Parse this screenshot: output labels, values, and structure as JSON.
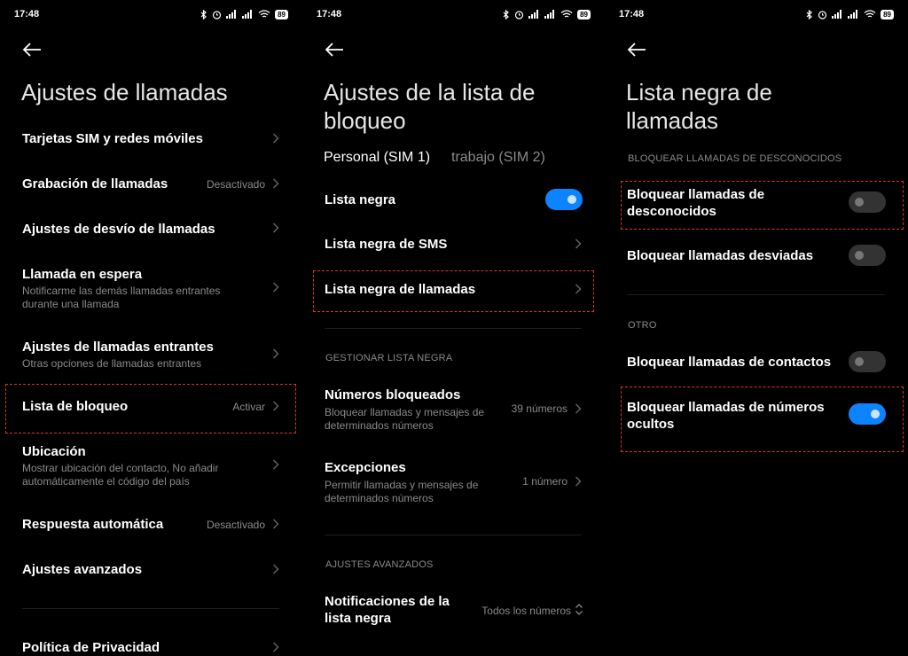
{
  "status": {
    "time": "17:48",
    "battery": "89"
  },
  "screen1": {
    "title": "Ajustes de llamadas",
    "items": [
      {
        "label": "Tarjetas SIM y redes móviles"
      },
      {
        "label": "Grabación de llamadas",
        "value": "Desactivado"
      },
      {
        "label": "Ajustes de desvío de llamadas"
      },
      {
        "label": "Llamada en espera",
        "sub1": "Notificarme las demás llamadas entrantes",
        "sub2": "durante una llamada"
      },
      {
        "label": "Ajustes de llamadas entrantes",
        "sub1": "Otras opciones de llamadas entrantes"
      },
      {
        "label": "Lista de bloqueo",
        "value": "Activar"
      },
      {
        "label": "Ubicación",
        "sub1": "Mostrar ubicación del contacto, No añadir",
        "sub2": "automáticamente el código del país"
      },
      {
        "label": "Respuesta automática",
        "value": "Desactivado"
      },
      {
        "label": "Ajustes avanzados"
      },
      {
        "label": "Política de Privacidad"
      }
    ]
  },
  "screen2": {
    "title1": "Ajustes de la lista de",
    "title2": "bloqueo",
    "tabs": [
      {
        "label": "Personal (SIM 1)"
      },
      {
        "label": "trabajo (SIM 2)"
      }
    ],
    "items": [
      {
        "label": "Lista negra",
        "toggle": true
      },
      {
        "label": "Lista negra de SMS"
      },
      {
        "label": "Lista negra de llamadas"
      }
    ],
    "section_manage": "GESTIONAR LISTA NEGRA",
    "manage_items": [
      {
        "label": "Números bloqueados",
        "sub1": "Bloquear llamadas y mensajes de",
        "sub2": "determinados números",
        "value": "39 números"
      },
      {
        "label": "Excepciones",
        "sub1": "Permitir llamadas y mensajes de",
        "sub2": "determinados números",
        "value": "1 número"
      }
    ],
    "section_advanced": "AJUSTES AVANZADOS",
    "advanced_item": {
      "label1": "Notificaciones de la",
      "label2": "lista negra",
      "value": "Todos los números"
    }
  },
  "screen3": {
    "title1": "Lista negra de",
    "title2": "llamadas",
    "section_unknown": "BLOQUEAR LLAMADAS DE DESCONOCIDOS",
    "items_unknown": [
      {
        "label1": "Bloquear llamadas de",
        "label2": "desconocidos",
        "toggle": false
      },
      {
        "label1": "Bloquear llamadas desviadas",
        "toggle": false
      }
    ],
    "section_other": "OTRO",
    "items_other": [
      {
        "label1": "Bloquear llamadas de contactos",
        "toggle": false
      },
      {
        "label1": "Bloquear llamadas de números",
        "label2": "ocultos",
        "toggle": true
      }
    ]
  },
  "colors": {
    "accent": "#0d84ff",
    "highlight": "#e03030",
    "secondary_text": "#8a8a8a"
  }
}
